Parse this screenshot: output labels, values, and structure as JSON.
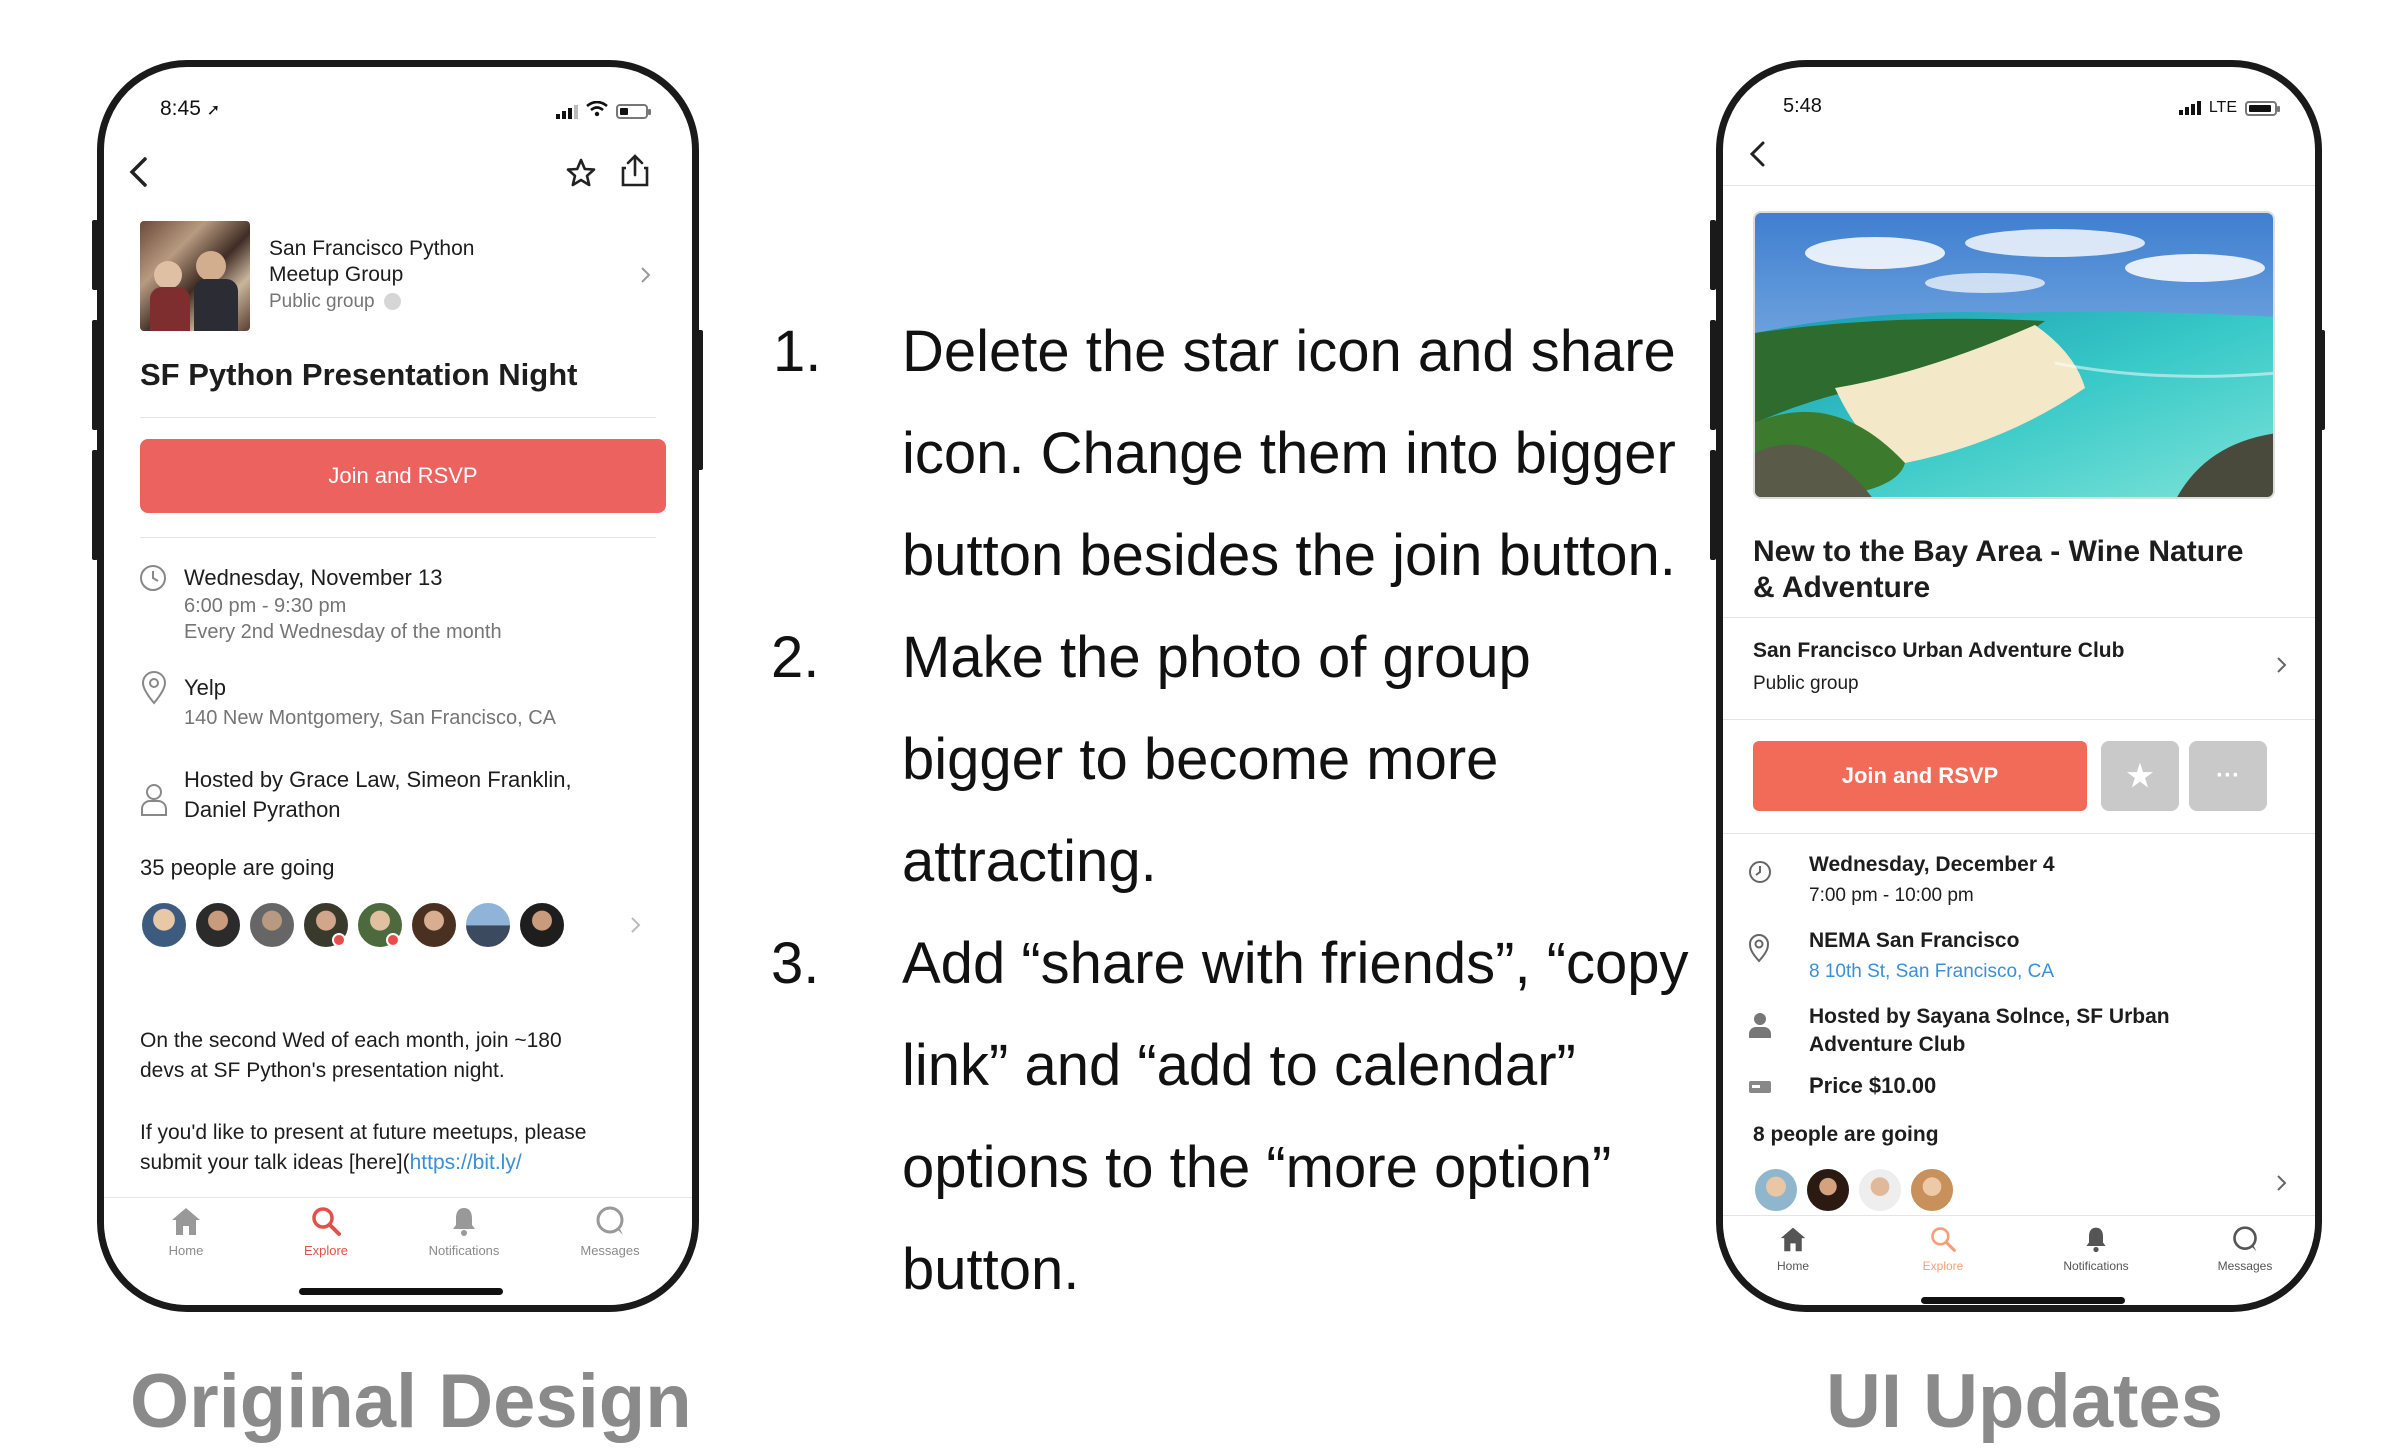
{
  "left_phone": {
    "status_time": "8:45",
    "group": {
      "name_line1": "San Francisco Python",
      "name_line2": "Meetup Group",
      "visibility": "Public group"
    },
    "event_title": "SF Python Presentation Night",
    "join_label": "Join and RSVP",
    "date": "Wednesday, November 13",
    "time": "6:00 pm - 9:30 pm",
    "recurrence": "Every 2nd Wednesday of the month",
    "venue": "Yelp",
    "address": "140 New Montgomery, San Francisco, CA",
    "hosts_line1": "Hosted by Grace Law, Simeon Franklin,",
    "hosts_line2": "Daniel Pyrathon",
    "going": "35 people are going",
    "desc1_line1": "On the second Wed of each month, join ~180",
    "desc1_line2": "devs at SF Python's presentation night.",
    "desc2_line1": "If you'd like to present at future meetups, please",
    "desc2_line2_prefix": "submit your talk ideas [here](",
    "desc2_link": "https://bit.ly/",
    "tabs": {
      "home": "Home",
      "explore": "Explore",
      "notifications": "Notifications",
      "messages": "Messages"
    }
  },
  "right_phone": {
    "status_time": "5:48",
    "network": "LTE",
    "event_title_line1": "New to the Bay Area - Wine Nature",
    "event_title_line2": "& Adventure",
    "group_name": "San Francisco Urban Adventure Club",
    "group_visibility": "Public group",
    "join_label": "Join and RSVP",
    "star_symbol": "★",
    "more_symbol": "···",
    "date": "Wednesday, December 4",
    "time": "7:00 pm - 10:00 pm",
    "venue": "NEMA San Francisco",
    "address": "8 10th St, San Francisco, CA",
    "hosts_line1": "Hosted by Sayana Solnce, SF Urban",
    "hosts_line2": "Adventure Club",
    "price": "Price $10.00",
    "going": "8 people are going",
    "tabs": {
      "home": "Home",
      "explore": "Explore",
      "notifications": "Notifications",
      "messages": "Messages"
    }
  },
  "instructions": [
    {
      "number": "1.",
      "lines": [
        "Delete the star icon and share",
        "icon. Change them into bigger",
        "button besides the join button."
      ]
    },
    {
      "number": "2.",
      "lines": [
        "Make the photo of group",
        "bigger to become more",
        "attracting."
      ]
    },
    {
      "number": "3.",
      "lines": [
        "Add “share with friends”, “copy",
        "link” and “add to calendar”",
        "options to the “more option”",
        "button."
      ]
    }
  ],
  "captions": {
    "left": "Original Design",
    "right": "UI Updates"
  },
  "colors": {
    "join_original": "#ec625f",
    "join_updated": "#f16b58",
    "explore_active": "#e2504c",
    "link_blue": "#3a8fd6",
    "grey_button": "#c9c9c9"
  }
}
